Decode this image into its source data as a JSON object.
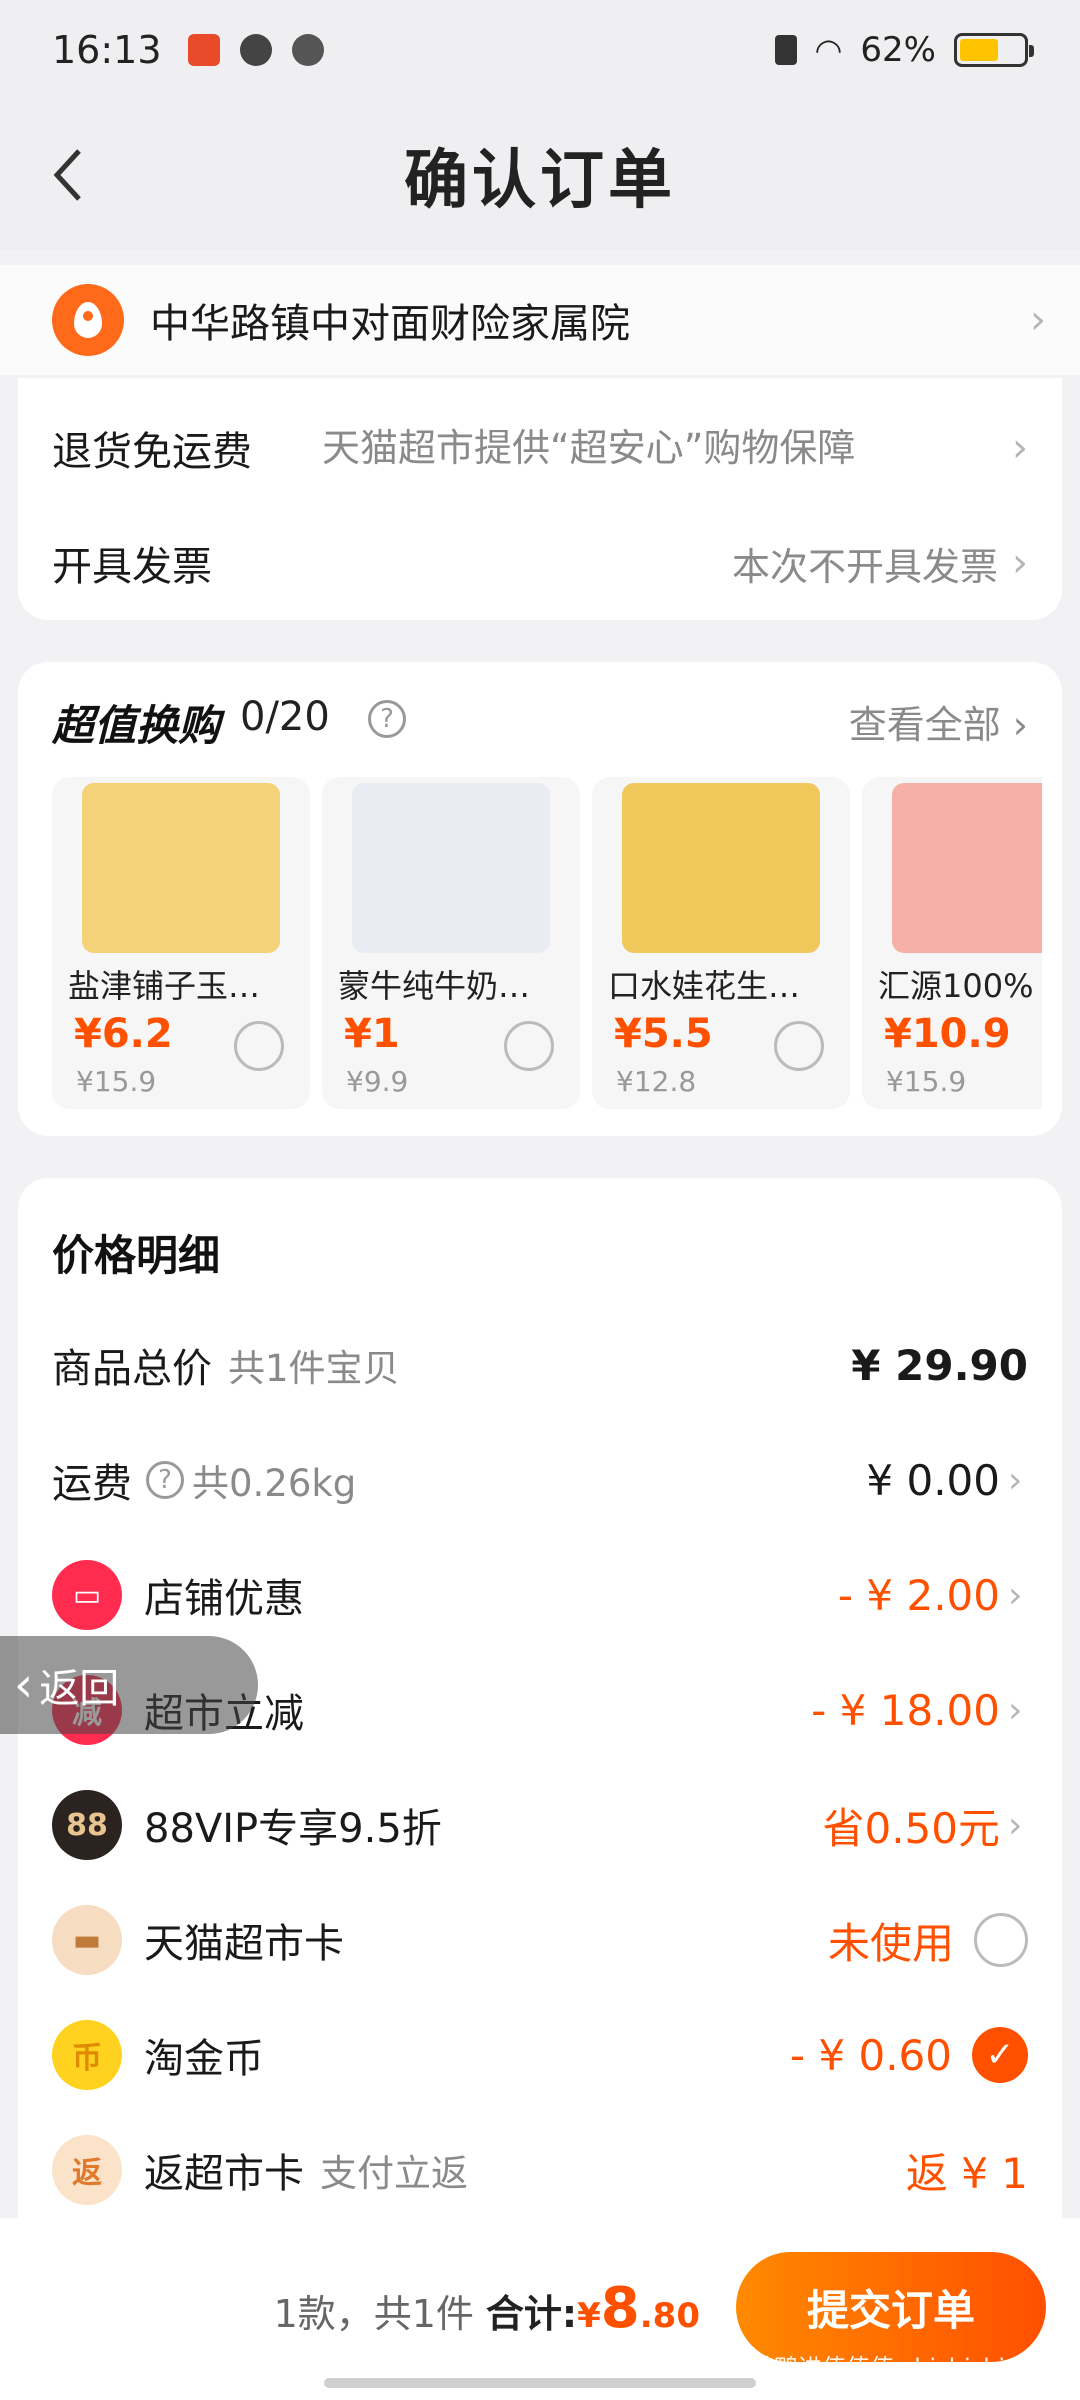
{
  "status_bar": {
    "time": "16:13",
    "battery": "62%",
    "battery_level": 0.62
  },
  "header": {
    "title": "确认订单"
  },
  "address": {
    "text": "中华路镇中对面财险家属院"
  },
  "order_options": [
    {
      "label": "退货免运费",
      "value": "天猫超市提供“超安心”购物保障"
    },
    {
      "label": "开具发票",
      "value": "本次不开具发票"
    }
  ],
  "promo": {
    "title": "超值换购",
    "count": "0/20",
    "view_all": "查看全部",
    "products": [
      {
        "name": "盐津铺子玉…",
        "price": "¥6.2",
        "original": "¥15.9",
        "color": "#f3d27a"
      },
      {
        "name": "蒙牛纯牛奶…",
        "price": "¥1",
        "original": "¥9.9",
        "color": "#e9ecf3"
      },
      {
        "name": "口水娃花生…",
        "price": "¥5.5",
        "original": "¥12.8",
        "color": "#f0c85c"
      },
      {
        "name": "汇源100%",
        "price": "¥10.9",
        "original": "¥15.9",
        "color": "#f6b0a8"
      }
    ]
  },
  "price_detail": {
    "title": "价格明细",
    "rows": [
      {
        "label": "商品总价",
        "sub": "共1件宝贝",
        "value": "¥ 29.90"
      },
      {
        "label": "运费",
        "sub": "共0.26kg",
        "value": "¥ 0.00"
      },
      {
        "label": "店铺优惠",
        "value": "- ¥ 2.00"
      },
      {
        "label": "超市立减",
        "value": "- ¥ 18.00",
        "icon_text": "减"
      },
      {
        "label": "88VIP专享9.5折",
        "value": "省0.50元",
        "icon_text": "88"
      },
      {
        "label": "天猫超市卡",
        "value": "未使用"
      },
      {
        "label": "淘金币",
        "value": "- ¥ 0.60"
      },
      {
        "label": "返超市卡",
        "sub": "支付立返",
        "value": "返 ¥ 1",
        "icon_text": "返"
      }
    ]
  },
  "floating_back": {
    "label": "返回"
  },
  "bottom_bar": {
    "summary": "1款，共1件",
    "total_label": "合计:",
    "currency": "¥",
    "total_int": "8",
    "total_dec": ".80",
    "submit": "提交订单",
    "watermark": "鸭鸭进值值值 zhizhizhi.com"
  },
  "colors": {
    "accent": "#ff5000",
    "background": "#f2f2f4"
  }
}
